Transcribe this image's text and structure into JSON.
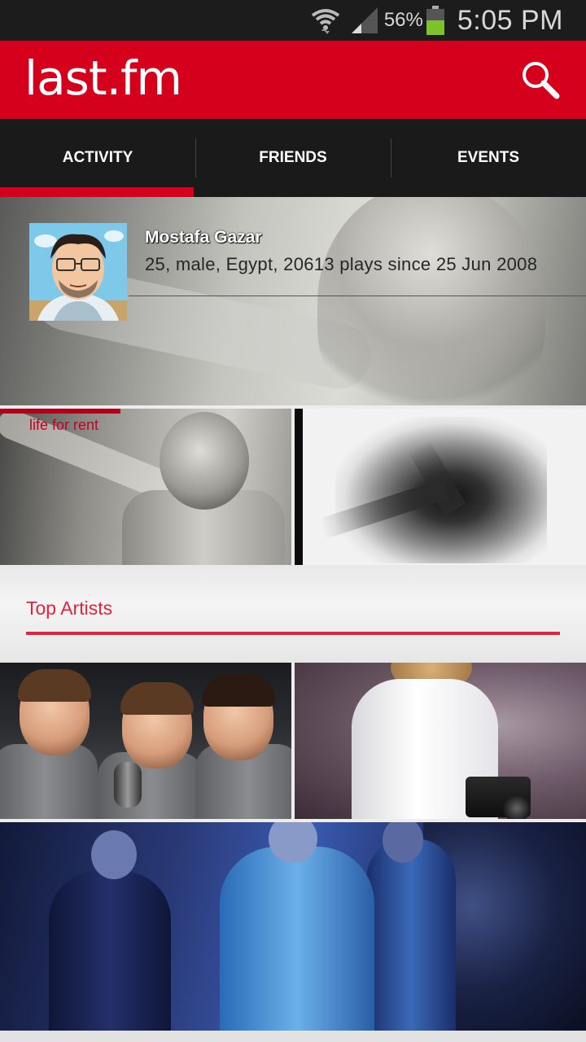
{
  "status_bar": {
    "battery_percent": "56%",
    "time": "5:05 PM",
    "battery_color": "#7dc22b"
  },
  "app_bar": {
    "logo": "last.fm",
    "brand_color": "#d5001c"
  },
  "tabs": [
    {
      "label": "ACTIVITY",
      "selected": true
    },
    {
      "label": "FRIENDS",
      "selected": false
    },
    {
      "label": "EVENTS",
      "selected": false
    }
  ],
  "profile": {
    "name": "Mostafa Gazar",
    "info": "25, male, Egypt, 20613 plays since 25 Jun 2008"
  },
  "recent_albums": [
    {
      "subtitle": "life for rent"
    },
    {
      "subtitle": ""
    }
  ],
  "top_artists": {
    "title": "Top Artists",
    "accent_color": "#e0243c"
  }
}
